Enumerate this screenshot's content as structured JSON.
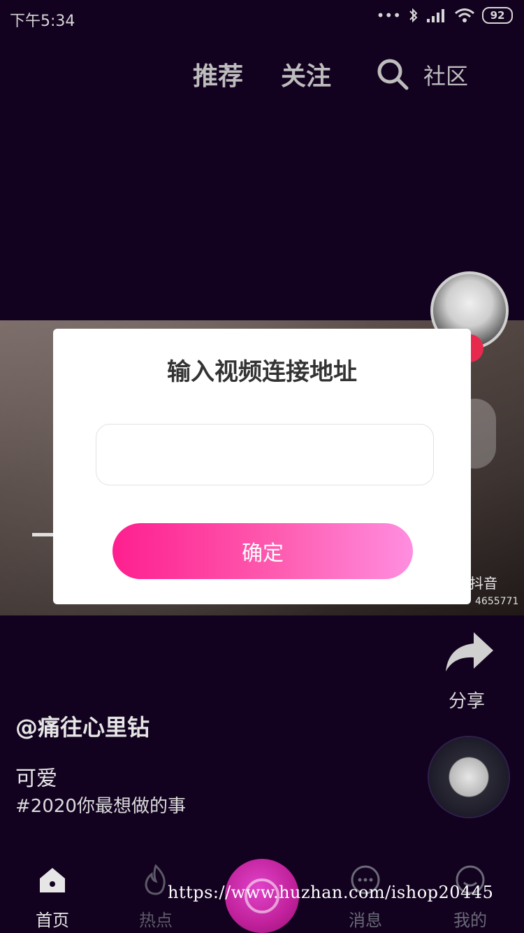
{
  "status_bar": {
    "time": "下午5:34",
    "signal_text": "•••",
    "battery": "92"
  },
  "top_nav": {
    "tabs": [
      {
        "label": "推荐"
      },
      {
        "label": "关注"
      }
    ],
    "community_label": "社区"
  },
  "video": {
    "watermark_brand": "抖音",
    "watermark_id": "4655771"
  },
  "side_actions": {
    "share_label": "分享"
  },
  "post": {
    "username": "@痛往心里钻",
    "caption": "可爱",
    "hashtag": "#2020你最想做的事"
  },
  "bottom_bar": {
    "home_label": "首页",
    "hot_label": "热点",
    "messages_label": "消息",
    "me_label": "我的"
  },
  "watermark_url": "https://www.huzhan.com/ishop20445",
  "dialog": {
    "title": "输入视频连接地址",
    "input_value": "",
    "input_placeholder": "",
    "confirm_label": "确定"
  },
  "colors": {
    "background": "#12021f",
    "accent_gradient_start": "#fe1f8f",
    "accent_gradient_end": "#ff8ee0",
    "follow_plus": "#e8294e"
  }
}
